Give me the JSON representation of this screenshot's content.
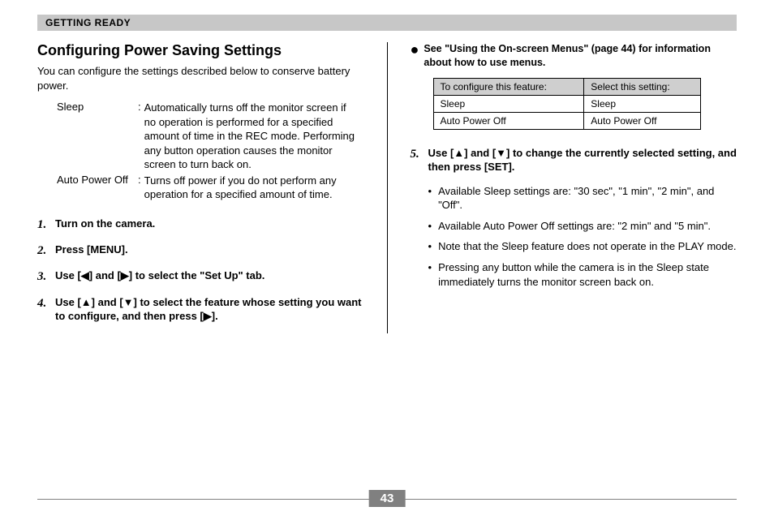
{
  "header": {
    "section": "GETTING READY"
  },
  "title": "Configuring Power Saving Settings",
  "intro": "You can configure the settings described below to conserve battery power.",
  "definitions": [
    {
      "term": "Sleep",
      "desc": "Automatically turns off the monitor screen if no operation is performed for a specified amount of time in the REC mode. Performing any button operation causes the monitor screen to turn back on."
    },
    {
      "term": "Auto Power Off",
      "desc": "Turns off power if you do not perform any operation for a specified amount of time."
    }
  ],
  "steps_left": [
    {
      "n": "1.",
      "text": "Turn on the camera."
    },
    {
      "n": "2.",
      "text": "Press [MENU]."
    },
    {
      "n": "3.",
      "text": "Use [◀] and [▶] to select the \"Set Up\" tab."
    },
    {
      "n": "4.",
      "text": "Use [▲] and [▼] to select the feature whose setting you want to configure, and then press [▶]."
    }
  ],
  "see_note": "See \"Using the On-screen Menus\" (page 44) for information about how to use menus.",
  "table": {
    "headers": [
      "To configure this feature:",
      "Select this setting:"
    ],
    "rows": [
      [
        "Sleep",
        "Sleep"
      ],
      [
        "Auto Power Off",
        "Auto Power Off"
      ]
    ]
  },
  "step5": {
    "n": "5.",
    "text": "Use [▲] and [▼] to change the currently selected setting, and then press [SET]."
  },
  "notes": [
    "Available Sleep settings are: \"30 sec\", \"1 min\", \"2 min\", and \"Off\".",
    "Available Auto Power Off settings are: \"2 min\" and \"5 min\".",
    "Note that the Sleep feature does not operate in the PLAY mode.",
    "Pressing any button while the camera is in the Sleep state immediately turns the monitor screen back on."
  ],
  "page_number": "43"
}
